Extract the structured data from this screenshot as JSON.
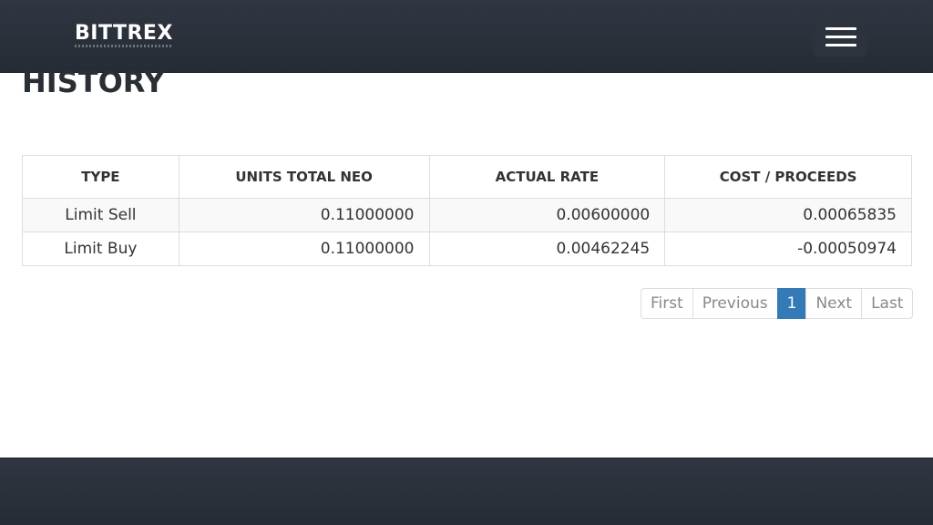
{
  "header": {
    "brand": "BITTREX",
    "menu_icon": "hamburger-menu-icon"
  },
  "main": {
    "title": "HISTORY",
    "table": {
      "columns": [
        "TYPE",
        "UNITS TOTAL NEO",
        "ACTUAL RATE",
        "COST / PROCEEDS"
      ],
      "rows": [
        {
          "type": "Limit Sell",
          "units": "0.11000000",
          "rate": "0.00600000",
          "cost": "0.00065835"
        },
        {
          "type": "Limit Buy",
          "units": "0.11000000",
          "rate": "0.00462245",
          "cost": "-0.00050974"
        }
      ]
    },
    "pagination": {
      "first": "First",
      "previous": "Previous",
      "current": "1",
      "next": "Next",
      "last": "Last"
    }
  },
  "colors": {
    "navbar": "#2b313a",
    "active_page": "#337ab7",
    "title_text": "#2a2f36"
  }
}
